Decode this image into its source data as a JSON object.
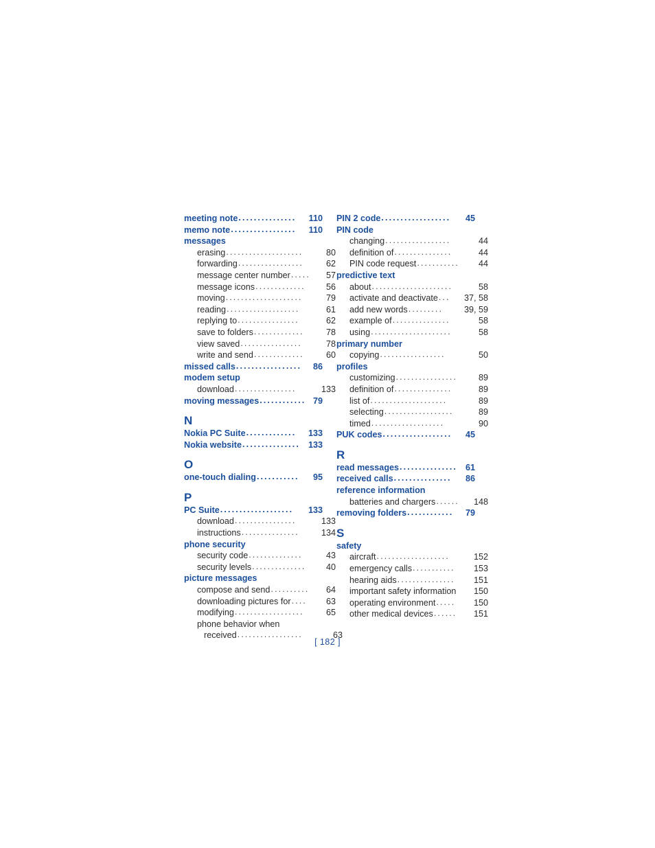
{
  "page": {
    "page_number_label": "[ 182 ]"
  },
  "index": {
    "columns": [
      {
        "id": "left",
        "blocks": [
          {
            "type": "entries",
            "entries": [
              {
                "level": "main",
                "label": "meeting note",
                "page": "110",
                "leader": "..............."
              },
              {
                "level": "main",
                "label": "memo note",
                "page": "110",
                "leader": "................."
              },
              {
                "level": "main",
                "label": "messages",
                "page": "",
                "leader": ""
              },
              {
                "level": "sub",
                "label": "erasing",
                "page": "80",
                "leader": "...................."
              },
              {
                "level": "sub",
                "label": "forwarding",
                "page": "62",
                "leader": "................."
              },
              {
                "level": "sub",
                "label": "message center number",
                "page": "57",
                "leader": "....."
              },
              {
                "level": "sub",
                "label": "message icons",
                "page": "56",
                "leader": "............."
              },
              {
                "level": "sub",
                "label": "moving",
                "page": "79",
                "leader": "...................."
              },
              {
                "level": "sub",
                "label": "reading",
                "page": "61",
                "leader": "..................."
              },
              {
                "level": "sub",
                "label": "replying to",
                "page": "62",
                "leader": "................"
              },
              {
                "level": "sub",
                "label": "save to folders",
                "page": "78",
                "leader": "............."
              },
              {
                "level": "sub",
                "label": "view saved",
                "page": "78",
                "leader": "................"
              },
              {
                "level": "sub",
                "label": "write and send",
                "page": "60",
                "leader": "............."
              },
              {
                "level": "main",
                "label": "missed calls",
                "page": "86",
                "leader": "................."
              },
              {
                "level": "main",
                "label": "modem setup",
                "page": "",
                "leader": ""
              },
              {
                "level": "sub",
                "label": "download",
                "page": "133",
                "leader": "................"
              },
              {
                "level": "main",
                "label": "moving messages",
                "page": "79",
                "leader": "............"
              }
            ]
          },
          {
            "type": "section",
            "letter": "N",
            "entries": [
              {
                "level": "main",
                "label": "Nokia PC Suite",
                "page": "133",
                "leader": "............."
              },
              {
                "level": "main",
                "label": "Nokia website",
                "page": "133",
                "leader": "..............."
              }
            ]
          },
          {
            "type": "section",
            "letter": "O",
            "entries": [
              {
                "level": "main",
                "label": "one-touch dialing",
                "page": "95",
                "leader": "..........."
              }
            ]
          },
          {
            "type": "section",
            "letter": "P",
            "entries": [
              {
                "level": "main",
                "label": "PC Suite",
                "page": "133",
                "leader": "..................."
              },
              {
                "level": "sub",
                "label": "download",
                "page": "133",
                "leader": "................"
              },
              {
                "level": "sub",
                "label": "instructions",
                "page": "134",
                "leader": "..............."
              },
              {
                "level": "main",
                "label": "phone security",
                "page": "",
                "leader": ""
              },
              {
                "level": "sub",
                "label": "security code",
                "page": "43",
                "leader": ".............."
              },
              {
                "level": "sub",
                "label": "security levels",
                "page": "40",
                "leader": ".............."
              },
              {
                "level": "main",
                "label": "picture messages",
                "page": "",
                "leader": ""
              },
              {
                "level": "sub",
                "label": "compose and send",
                "page": "64",
                "leader": ".........."
              },
              {
                "level": "sub",
                "label": "downloading pictures for",
                "page": "63",
                "leader": "...."
              },
              {
                "level": "sub",
                "label": "modifying",
                "page": "65",
                "leader": ".................."
              },
              {
                "level": "sub-wrap-first",
                "label": "phone behavior when",
                "page": "",
                "leader": ""
              },
              {
                "level": "sub-wrap-cont",
                "label": "received",
                "page": "63",
                "leader": "................."
              }
            ]
          }
        ]
      },
      {
        "id": "right",
        "blocks": [
          {
            "type": "entries",
            "entries": [
              {
                "level": "main",
                "label": "PIN 2 code",
                "page": "45",
                "leader": ".................."
              },
              {
                "level": "main",
                "label": "PIN code",
                "page": "",
                "leader": ""
              },
              {
                "level": "sub",
                "label": "changing",
                "page": "44",
                "leader": "................."
              },
              {
                "level": "sub",
                "label": "definition of",
                "page": "44",
                "leader": "..............."
              },
              {
                "level": "sub",
                "label": "PIN code request",
                "page": "44",
                "leader": "..........."
              },
              {
                "level": "main",
                "label": "predictive text",
                "page": "",
                "leader": ""
              },
              {
                "level": "sub",
                "label": "about",
                "page": "58",
                "leader": "....................."
              },
              {
                "level": "sub",
                "label": "activate and deactivate",
                "page": "37, 58",
                "leader": "..."
              },
              {
                "level": "sub",
                "label": "add new words",
                "page": "39, 59",
                "leader": "........."
              },
              {
                "level": "sub",
                "label": "example of",
                "page": "58",
                "leader": "..............."
              },
              {
                "level": "sub",
                "label": "using",
                "page": "58",
                "leader": "....................."
              },
              {
                "level": "main",
                "label": "primary number",
                "page": "",
                "leader": ""
              },
              {
                "level": "sub",
                "label": "copying",
                "page": "50",
                "leader": "................."
              },
              {
                "level": "main",
                "label": "profiles",
                "page": "",
                "leader": ""
              },
              {
                "level": "sub",
                "label": "customizing",
                "page": "89",
                "leader": "................"
              },
              {
                "level": "sub",
                "label": "definition of",
                "page": "89",
                "leader": "..............."
              },
              {
                "level": "sub",
                "label": "list of",
                "page": "89",
                "leader": "...................."
              },
              {
                "level": "sub",
                "label": "selecting",
                "page": "89",
                "leader": ".................."
              },
              {
                "level": "sub",
                "label": "timed",
                "page": "90",
                "leader": "..................."
              },
              {
                "level": "main",
                "label": "PUK codes",
                "page": "45",
                "leader": ".................."
              }
            ]
          },
          {
            "type": "section",
            "letter": "R",
            "entries": [
              {
                "level": "main",
                "label": "read messages",
                "page": "61",
                "leader": "..............."
              },
              {
                "level": "main",
                "label": "received calls",
                "page": "86",
                "leader": "..............."
              },
              {
                "level": "main",
                "label": "reference information",
                "page": "",
                "leader": ""
              },
              {
                "level": "sub",
                "label": "batteries and chargers",
                "page": "148",
                "leader": "......"
              },
              {
                "level": "main",
                "label": "removing folders",
                "page": "79",
                "leader": "............"
              }
            ]
          },
          {
            "type": "section",
            "letter": "S",
            "entries": [
              {
                "level": "main",
                "label": "safety",
                "page": "",
                "leader": ""
              },
              {
                "level": "sub",
                "label": "aircraft",
                "page": "152",
                "leader": "..................."
              },
              {
                "level": "sub",
                "label": "emergency calls",
                "page": "153",
                "leader": "..........."
              },
              {
                "level": "sub",
                "label": "hearing aids",
                "page": "151",
                "leader": "..............."
              },
              {
                "level": "sub-nodots",
                "label": "important safety information",
                "page": "150",
                "leader": ""
              },
              {
                "level": "sub",
                "label": "operating environment",
                "page": "150",
                "leader": "....."
              },
              {
                "level": "sub",
                "label": "other medical devices",
                "page": "151",
                "leader": "......"
              }
            ]
          }
        ]
      }
    ]
  }
}
